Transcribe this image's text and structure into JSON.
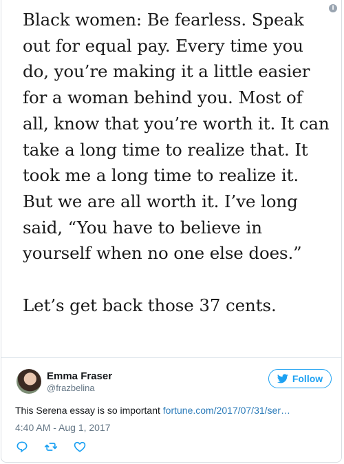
{
  "quote": {
    "paragraphs": [
      "Black women: Be fearless. Speak out for equal pay. Every time you do, you’re making it a little easier for a woman behind you. Most of all, know that you’re worth it. It can take a long time to realize that. It took me a long time to realize it. But we are all worth it. I’ve long said, “You have to believe in yourself when no one else does.”",
      "Let’s get back those 37 cents."
    ]
  },
  "author": {
    "name": "Emma Fraser",
    "handle": "@frazbelina",
    "follow_label": "Follow"
  },
  "tweet": {
    "text": "This Serena essay is so important ",
    "link": "fortune.com/2017/07/31/ser…",
    "timestamp": "4:40 AM - Aug 1, 2017"
  },
  "icons": {
    "info": "info-icon",
    "follow": "twitter-bird-icon",
    "reply": "reply-icon",
    "retweet": "retweet-icon",
    "like": "heart-icon"
  },
  "colors": {
    "accent": "#1da1f2",
    "link": "#2b7bb9",
    "muted": "#657786"
  }
}
